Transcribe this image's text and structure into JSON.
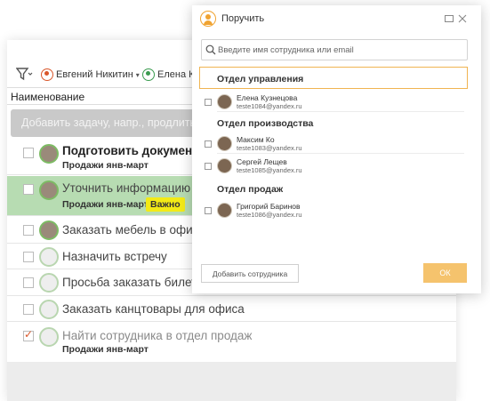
{
  "toolbar": {
    "users": [
      {
        "name": "Евгений Никитин",
        "caret": "▾"
      },
      {
        "name": "Елена Ку"
      }
    ]
  },
  "list": {
    "column_header": "Наименование",
    "add_task_placeholder": "Добавить задачу, напр., продлить аб",
    "tasks": [
      {
        "title": "Подготовить документы",
        "subtitle": "Продажи янв-март",
        "bold": true
      },
      {
        "title": "Уточнить информацию по",
        "subtitle": "Продажи янв-март",
        "badge": "Важно",
        "highlight": true
      },
      {
        "title": "Заказать мебель в офис"
      },
      {
        "title": "Назначить встречу"
      },
      {
        "title": "Просьба заказать билет на"
      },
      {
        "title": "Заказать канцтовары для офиса"
      },
      {
        "title": "Найти сотрудника в отдел продаж",
        "subtitle": "Продажи янв-март",
        "done": true
      }
    ]
  },
  "dialog": {
    "title": "Поручить",
    "search_placeholder": "Введите имя сотрудника или email",
    "departments": [
      {
        "name": "Отдел управления",
        "employees": [
          {
            "name": "Елена Кузнецова",
            "email": "teste1084@yandex.ru"
          }
        ]
      },
      {
        "name": "Отдел производства",
        "employees": [
          {
            "name": "Максим Ко",
            "email": "teste1083@yandex.ru"
          },
          {
            "name": "Сергей Лещев",
            "email": "teste1085@yandex.ru"
          }
        ]
      },
      {
        "name": "Отдел продаж",
        "employees": [
          {
            "name": "Григорий Баринов",
            "email": "teste1086@yandex.ru"
          }
        ]
      }
    ],
    "add_employee_label": "Добавить сотрудника",
    "ok_label": "ОК",
    "accent_color": "#f0a331"
  }
}
